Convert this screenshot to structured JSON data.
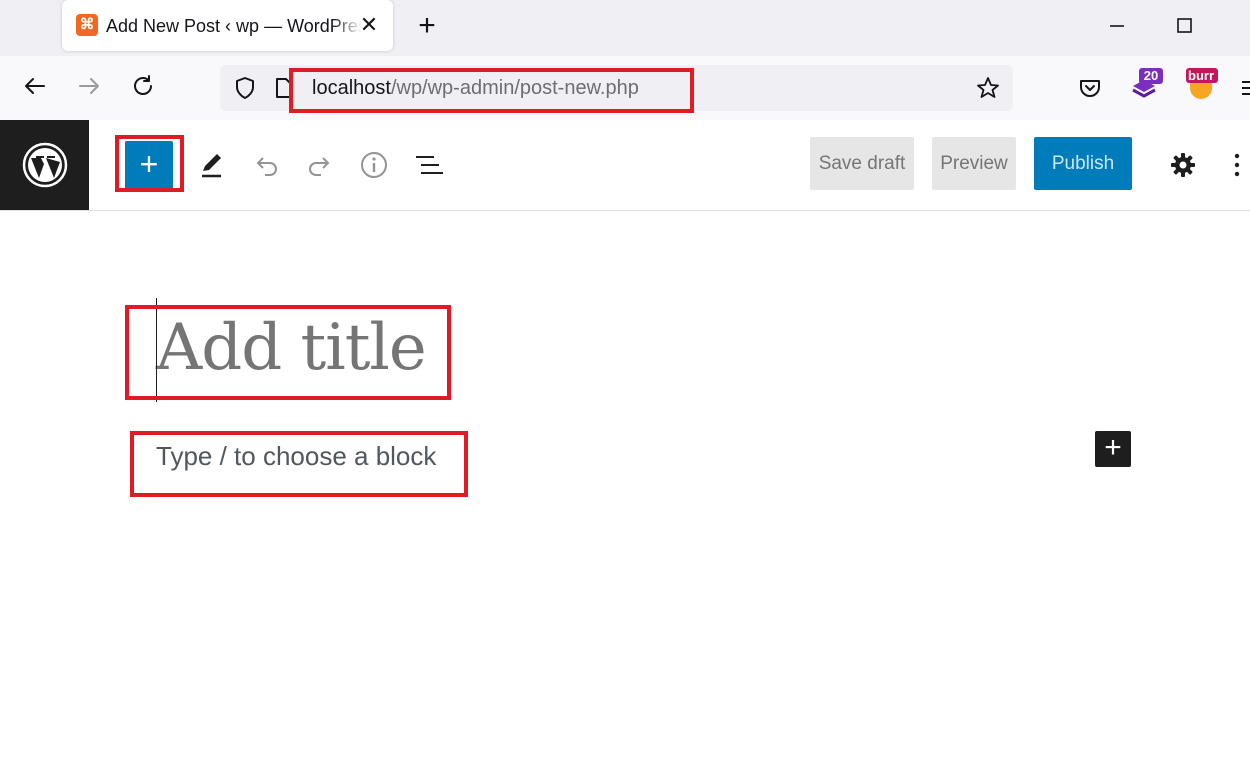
{
  "browser": {
    "tab_title": "Add New Post ‹ wp — WordPress",
    "favicon_glyph": "⌘",
    "close_glyph": "✕",
    "new_tab_glyph": "+",
    "url_host": "localhost",
    "url_path": "/wp/wp-admin/post-new.php",
    "extension_badge": "20",
    "extension_label": "burr",
    "icons": [
      "back-icon",
      "forward-icon",
      "reload-icon",
      "shield-icon",
      "page-icon",
      "star-icon",
      "pocket-icon",
      "extension-icon",
      "menu-icon"
    ]
  },
  "editor": {
    "toolbar": {
      "inserter_label": "+",
      "save_draft_label": "Save draft",
      "preview_label": "Preview",
      "publish_label": "Publish",
      "icons": [
        "wordpress-logo-icon",
        "pen-tool-icon",
        "undo-icon",
        "redo-icon",
        "info-icon",
        "list-view-icon",
        "settings-gear-icon",
        "more-options-icon"
      ]
    },
    "title_placeholder": "Add title",
    "block_placeholder": "Type / to choose a block",
    "block_add_label": "+"
  },
  "colors": {
    "accent": "#007cba",
    "highlight_box": "#e01b24",
    "wp_dark": "#1e1e1e"
  }
}
